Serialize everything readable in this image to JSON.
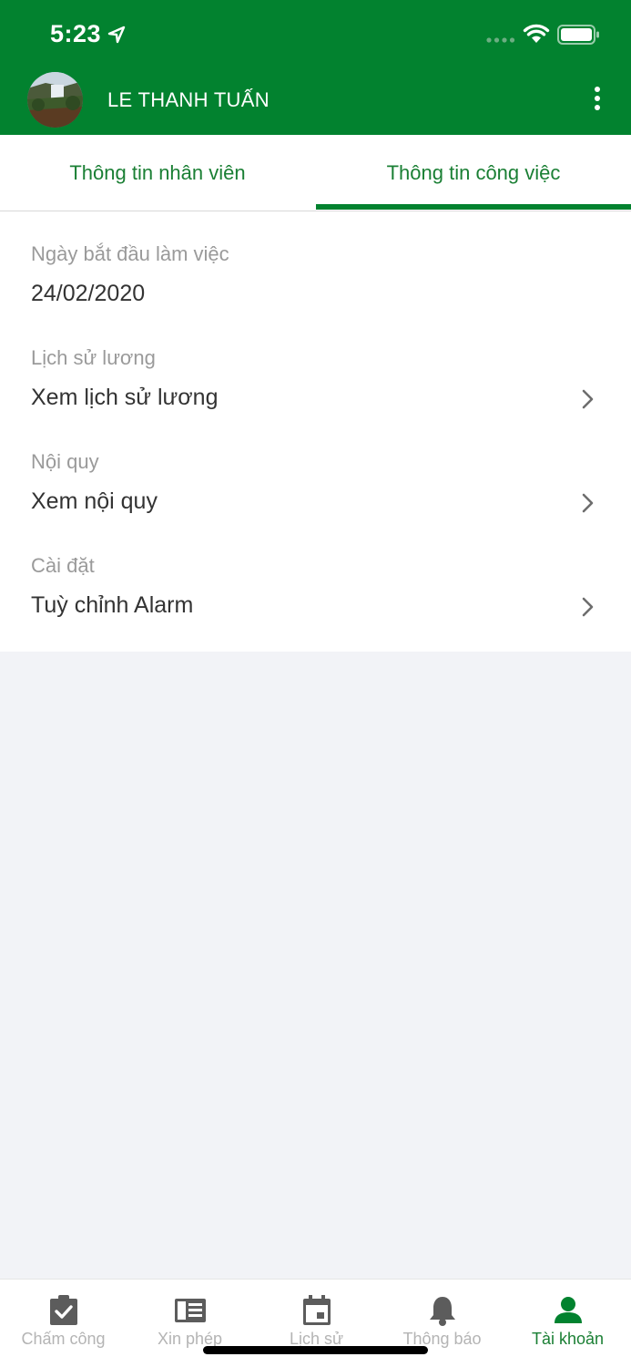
{
  "status_bar": {
    "time": "5:23",
    "icons": [
      "location-arrow-icon",
      "cellular-signal-icon",
      "wifi-icon",
      "battery-icon"
    ]
  },
  "header": {
    "username": "LE THANH TUẤN",
    "menu_icon": "more-vertical-icon",
    "avatar": "avatar-waterfall-image"
  },
  "tabs": [
    {
      "label": "Thông tin nhân viên",
      "active": false
    },
    {
      "label": "Thông tin công việc",
      "active": true
    }
  ],
  "fields": [
    {
      "label": "Ngày bắt đầu làm việc",
      "value": "24/02/2020",
      "navigable": false
    },
    {
      "label": "Lịch sử lương",
      "value": "Xem lịch sử lương",
      "navigable": true
    },
    {
      "label": "Nội quy",
      "value": "Xem nội quy",
      "navigable": true
    },
    {
      "label": "Cài đặt",
      "value": "Tuỳ chỉnh Alarm",
      "navigable": true
    }
  ],
  "tabbar": [
    {
      "label": "Chấm công",
      "icon": "clipboard-check-icon",
      "active": false
    },
    {
      "label": "Xin phép",
      "icon": "document-list-icon",
      "active": false
    },
    {
      "label": "Lịch sử",
      "icon": "calendar-icon",
      "active": false
    },
    {
      "label": "Thông báo",
      "icon": "bell-icon",
      "active": false
    },
    {
      "label": "Tài khoản",
      "icon": "person-icon",
      "active": true
    }
  ],
  "colors": {
    "brand_green": "#02822F",
    "tab_text_green": "#1A7F34",
    "label_gray": "#9A9A9A",
    "value_dark": "#333333",
    "background": "#F2F3F7",
    "inactive_tab": "#B4B4B4"
  }
}
